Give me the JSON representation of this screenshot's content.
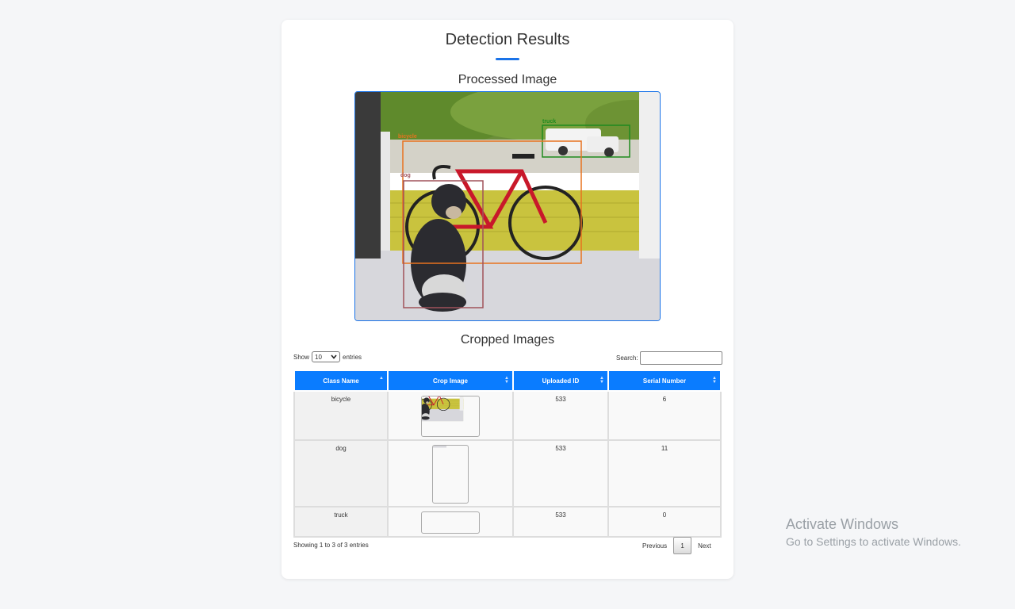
{
  "page": {
    "title": "Detection Results",
    "processed_heading": "Processed Image",
    "cropped_heading": "Cropped Images"
  },
  "detections_overlay": [
    {
      "label": "truck",
      "color": "#1e8a1e"
    },
    {
      "label": "bicycle",
      "color": "#e8731f"
    },
    {
      "label": "dog",
      "color": "#a0525a"
    }
  ],
  "datatable": {
    "show_label": "Show",
    "length_value": "10",
    "entries_label": "entries",
    "search_label": "Search:",
    "search_value": "",
    "columns": [
      "Class Name",
      "Crop Image",
      "Uploaded ID",
      "Serial Number"
    ],
    "rows": [
      {
        "class_name": "bicycle",
        "crop_image": "bicycle crop",
        "uploaded_id": "533",
        "serial_number": "6"
      },
      {
        "class_name": "dog",
        "crop_image": "dog crop",
        "uploaded_id": "533",
        "serial_number": "11"
      },
      {
        "class_name": "truck",
        "crop_image": "truck crop",
        "uploaded_id": "533",
        "serial_number": "0"
      }
    ],
    "info": "Showing 1 to 3 of 3 entries",
    "previous_label": "Previous",
    "current_page": "1",
    "next_label": "Next"
  },
  "watermark": {
    "line1": "Activate Windows",
    "line2": "Go to Settings to activate Windows."
  },
  "colors": {
    "accent": "#1a73e8",
    "table_header": "#0a7cff"
  }
}
